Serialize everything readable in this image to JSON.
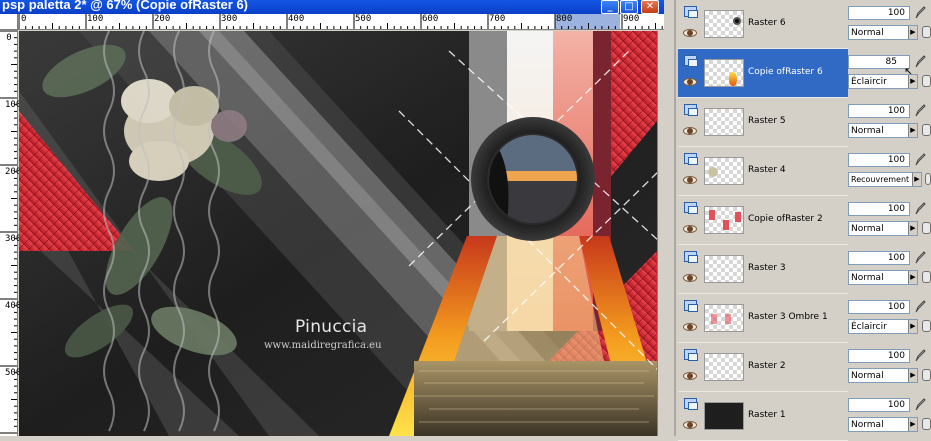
{
  "window": {
    "title": "psp paletta 2* @  67% (Copie ofRaster 6)",
    "min_glyph": "_",
    "max_glyph": "□",
    "close_glyph": "✕"
  },
  "ruler_h": [
    "0",
    "100",
    "200",
    "300",
    "400",
    "500",
    "600",
    "700",
    "800",
    "900"
  ],
  "ruler_v": [
    "0",
    "100",
    "200",
    "300",
    "400",
    "500"
  ],
  "canvas": {
    "watermark_name": "Pinuccia",
    "watermark_url": "www.maidiregrafica.eu"
  },
  "layers": [
    {
      "name": "Raster 6",
      "opacity": "100",
      "blend": "Normal",
      "selected": false,
      "thumb": "ball"
    },
    {
      "name": "Copie ofRaster 6",
      "opacity": "85",
      "blend": "Éclaircir",
      "selected": true,
      "thumb": "flame"
    },
    {
      "name": "Raster 5",
      "opacity": "100",
      "blend": "Normal",
      "selected": false,
      "thumb": "empty"
    },
    {
      "name": "Raster 4",
      "opacity": "100",
      "blend": "Recouvrement",
      "selected": false,
      "thumb": "flower"
    },
    {
      "name": "Copie ofRaster 2",
      "opacity": "100",
      "blend": "Normal",
      "selected": false,
      "thumb": "red"
    },
    {
      "name": "Raster 3",
      "opacity": "100",
      "blend": "Normal",
      "selected": false,
      "thumb": "empty"
    },
    {
      "name": "Raster 3 Ombre 1",
      "opacity": "100",
      "blend": "Éclaircir",
      "selected": false,
      "thumb": "red"
    },
    {
      "name": "Raster 2",
      "opacity": "100",
      "blend": "Normal",
      "selected": false,
      "thumb": "empty"
    },
    {
      "name": "Raster 1",
      "opacity": "100",
      "blend": "Normal",
      "selected": false,
      "thumb": "dark"
    }
  ],
  "colors": {
    "accent": "#316ac5",
    "titlebar": "#0a3fc6",
    "canvas_red": "#e0323c"
  }
}
